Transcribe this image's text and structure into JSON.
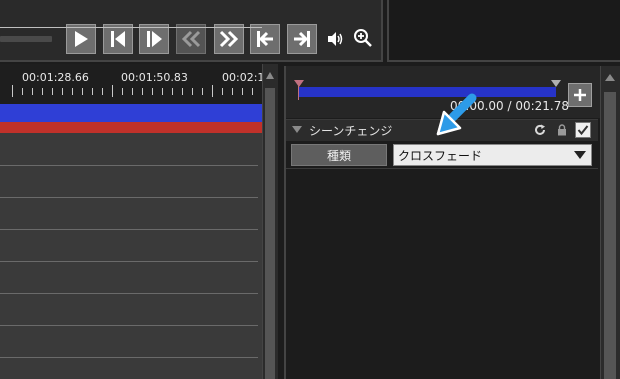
{
  "transport": {
    "buttons": [
      {
        "name": "play-button",
        "icon": "play-icon",
        "enabled": true
      },
      {
        "name": "prev-frame-button",
        "icon": "step-back-icon",
        "enabled": true
      },
      {
        "name": "next-frame-button",
        "icon": "step-forward-icon",
        "enabled": true
      },
      {
        "name": "rewind-button",
        "icon": "rewind-icon",
        "enabled": false
      },
      {
        "name": "fast-forward-button",
        "icon": "fast-forward-icon",
        "enabled": true
      },
      {
        "name": "go-to-start-button",
        "icon": "skip-start-icon",
        "enabled": true
      },
      {
        "name": "go-to-end-button",
        "icon": "skip-end-icon",
        "enabled": true
      }
    ],
    "volume_icon": "volume-icon",
    "zoom_icon": "zoom-in-icon"
  },
  "timeline": {
    "timecodes": [
      "00:01:28.66",
      "00:01:50.83",
      "00:02:1"
    ],
    "track_colors": {
      "video": "#2f3fd6",
      "audio": "#c0312a"
    }
  },
  "properties": {
    "time_readout": "00:00.00 / 00:21.78",
    "add_label": "+",
    "section_title": "シーンチェンジ",
    "kind_label": "種類",
    "kind_value": "クロスフェード",
    "enabled": true
  },
  "colors": {
    "accent_blue": "#2633c8",
    "pointer": "#2d9be8"
  }
}
